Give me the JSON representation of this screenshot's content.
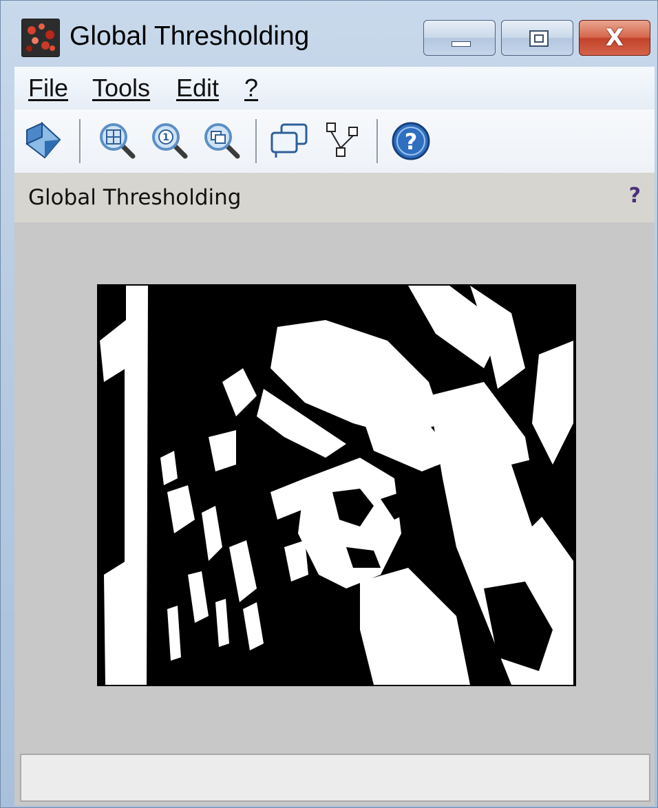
{
  "window": {
    "title": "Global Thresholding",
    "close_symbol": "X"
  },
  "menu": {
    "items": [
      {
        "label": "File"
      },
      {
        "label": "Tools"
      },
      {
        "label": "Edit"
      },
      {
        "label": "?"
      }
    ]
  },
  "toolbar": {
    "icons": [
      "select-tool-icon",
      "zoom-grid-icon",
      "zoom-actual-icon",
      "zoom-fit-icon",
      "new-window-icon",
      "graph-icon",
      "help-icon"
    ]
  },
  "panel": {
    "title": "Global Thresholding",
    "help_symbol": "?"
  },
  "image": {
    "description_name": "thresholded-binary-image",
    "colors": [
      "#000000",
      "#ffffff"
    ]
  },
  "status": {
    "text": ""
  },
  "colors": {
    "window_frame": "#bfd0e4",
    "close_button": "#c8452b",
    "panel_header": "#d7d5cf",
    "content_bg": "#c8c8c8",
    "help_accent": "#4b2f7a"
  }
}
